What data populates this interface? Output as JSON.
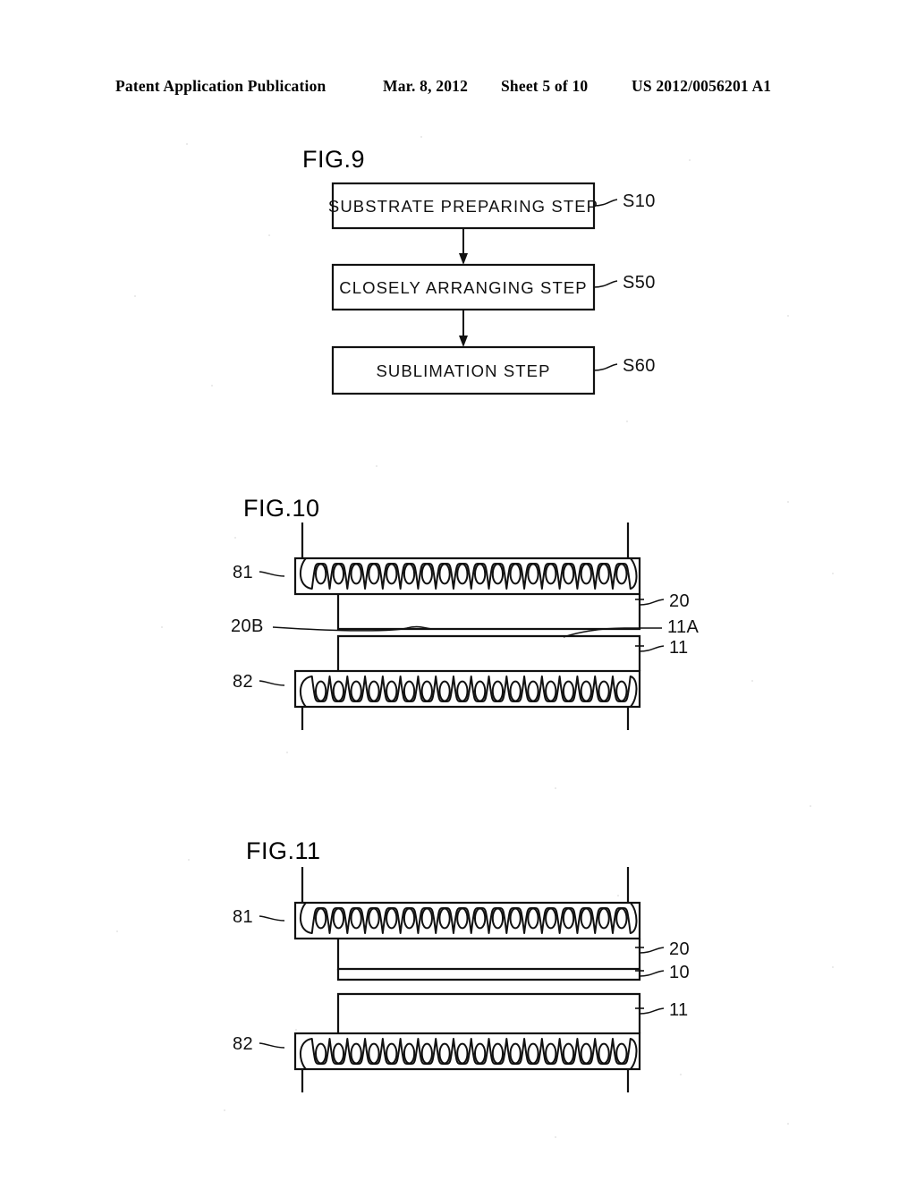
{
  "header": {
    "publication": "Patent Application Publication",
    "date": "Mar. 8, 2012",
    "sheet": "Sheet 5 of 10",
    "doc_number": "US 2012/0056201 A1"
  },
  "figures": [
    {
      "id": "fig9",
      "title": "FIG.9",
      "type": "flowchart",
      "steps": [
        {
          "label": "SUBSTRATE PREPARING STEP",
          "ref": "S10"
        },
        {
          "label": "CLOSELY ARRANGING STEP",
          "ref": "S50"
        },
        {
          "label": "SUBLIMATION STEP",
          "ref": "S60"
        }
      ]
    },
    {
      "id": "fig10",
      "title": "FIG.10",
      "type": "cross-section",
      "refs": {
        "upper_heater": "81",
        "lower_heater": "82",
        "upper_block": "20",
        "upper_block_surface": "20B",
        "lower_block_surface": "11A",
        "lower_block": "11"
      }
    },
    {
      "id": "fig11",
      "title": "FIG.11",
      "type": "cross-section",
      "refs": {
        "upper_heater": "81",
        "lower_heater": "82",
        "upper_block": "20",
        "thin_layer": "10",
        "lower_block": "11"
      }
    }
  ],
  "colors": {
    "ink": "#111111",
    "paper": "#ffffff"
  }
}
